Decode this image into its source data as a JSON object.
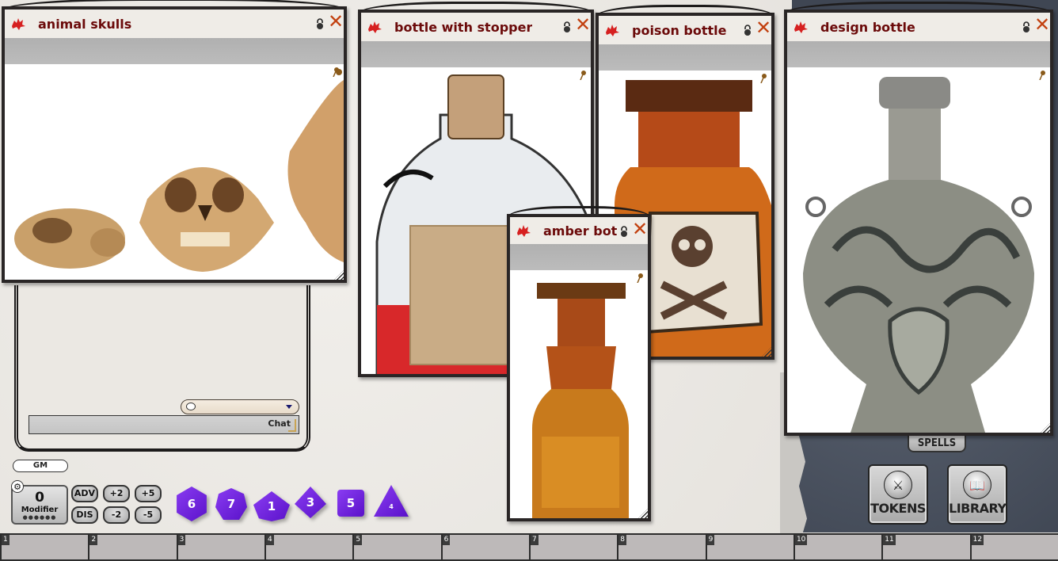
{
  "windows": [
    {
      "id": "animal-skulls",
      "title": "animal skulls",
      "image": "three animal skulls"
    },
    {
      "id": "bottle-with-stopper",
      "title": "bottle with stopper",
      "image": "clear glass bottle with cork stopper and blank label"
    },
    {
      "id": "poison-bottle",
      "title": "poison bottle",
      "image": "amber bottle with skull and crossbones label"
    },
    {
      "id": "amber-bot",
      "title": "amber bot",
      "image": "amber glass apothecary bottle"
    },
    {
      "id": "design-bottle",
      "title": "design bottle",
      "image": "ornate engraved silver flask"
    }
  ],
  "window_controls": {
    "lock_icon": "lock-icon",
    "close_icon": "close-icon",
    "close_glyph": "✕",
    "pin_icon": "pin-icon"
  },
  "chat": {
    "mode_icon": "speech-bubble-icon",
    "input_label": "Chat"
  },
  "identity": {
    "badge": "GM"
  },
  "modifier": {
    "value": "0",
    "label": "Modifier",
    "dots": "●●●●●●"
  },
  "modifier_buttons": [
    {
      "label": "ADV"
    },
    {
      "label": "+2"
    },
    {
      "label": "+5"
    },
    {
      "label": "DIS"
    },
    {
      "label": "-2"
    },
    {
      "label": "-5"
    }
  ],
  "dice": [
    {
      "type": "d20",
      "face": "6"
    },
    {
      "type": "d12",
      "face": "7"
    },
    {
      "type": "d10",
      "face": "1"
    },
    {
      "type": "d8",
      "face": "3"
    },
    {
      "type": "d6",
      "face": "5"
    },
    {
      "type": "d4",
      "face": "4"
    }
  ],
  "sidebar": {
    "spells_label": "SPELLS",
    "tokens_label": "TOKENS",
    "library_label": "LIBRARY"
  },
  "hotkeys": [
    "1",
    "2",
    "3",
    "4",
    "5",
    "6",
    "7",
    "8",
    "9",
    "10",
    "11",
    "12"
  ],
  "colors": {
    "title": "#6b0a0a",
    "close": "#c2400f",
    "dice": "#6a1de0"
  }
}
